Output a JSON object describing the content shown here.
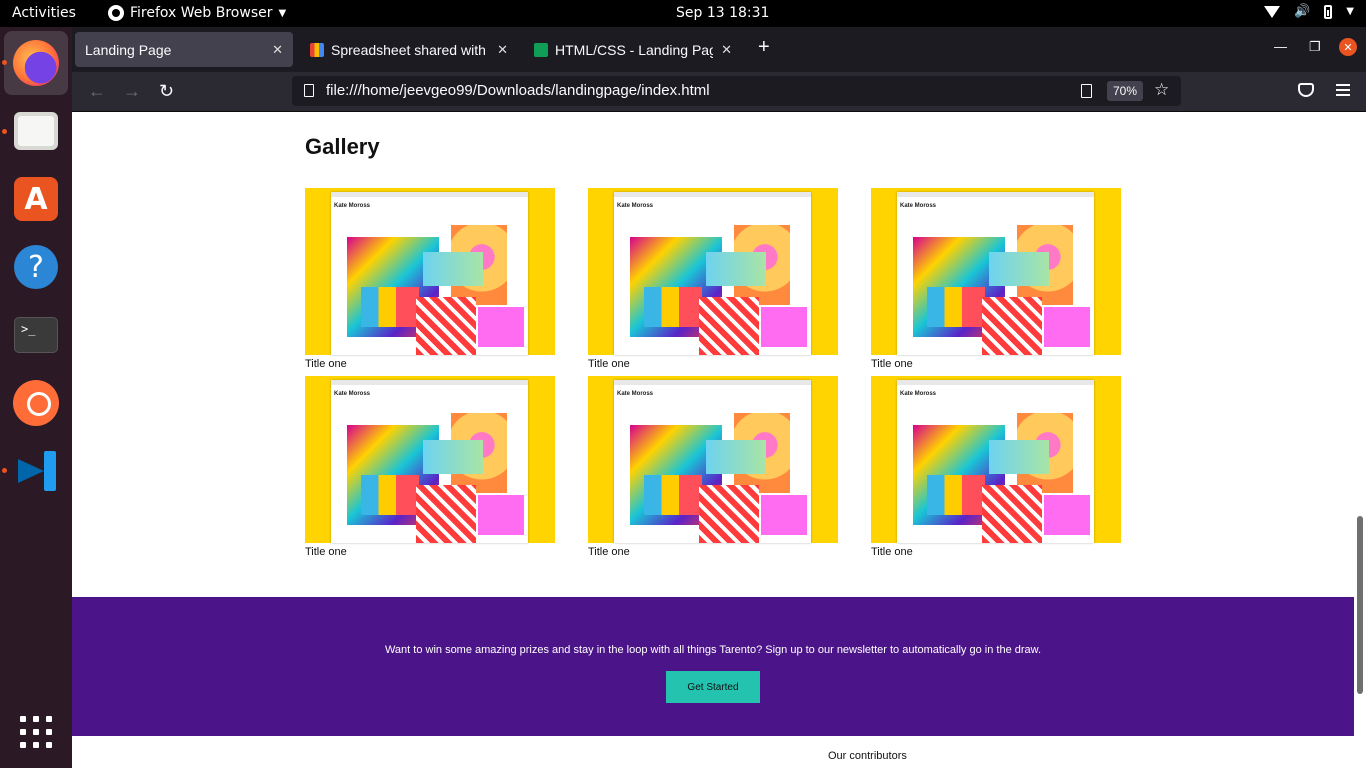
{
  "system": {
    "activities": "Activities",
    "app_name": "Firefox Web Browser",
    "clock": "Sep 13  18:31"
  },
  "dock": {
    "items": [
      "firefox",
      "files",
      "app-center",
      "help",
      "terminal",
      "postman",
      "vscode",
      "show-apps"
    ]
  },
  "browser": {
    "tabs": [
      {
        "label": "Landing Page",
        "active": true,
        "close": "✕"
      },
      {
        "label": "Spreadsheet shared with",
        "close": "✕"
      },
      {
        "label": "HTML/CSS - Landing Page",
        "close": "✕"
      }
    ],
    "new_tab": "+",
    "url": "file:///home/jeevgeo99/Downloads/landingpage/index.html",
    "zoom": "70%"
  },
  "page": {
    "gallery_title": "Gallery",
    "gallery": [
      {
        "image_caption": "Kate Moross",
        "title": "Title one"
      },
      {
        "image_caption": "Kate Moross",
        "title": "Title one"
      },
      {
        "image_caption": "Kate Moross",
        "title": "Title one"
      },
      {
        "image_caption": "Kate Moross",
        "title": "Title one"
      },
      {
        "image_caption": "Kate Moross",
        "title": "Title one"
      },
      {
        "image_caption": "Kate Moross",
        "title": "Title one"
      }
    ],
    "newsletter": {
      "text": "Want to win some amazing prizes and stay in the loop with all things Tarento? Sign up to our newsletter to automatically go in the draw.",
      "button": "Get Started"
    },
    "contributors_heading": "Our contributors"
  },
  "colors": {
    "newsletter_bg": "#4b1589",
    "button_bg": "#23c3b0",
    "gallery_bg": "#ffd400"
  }
}
